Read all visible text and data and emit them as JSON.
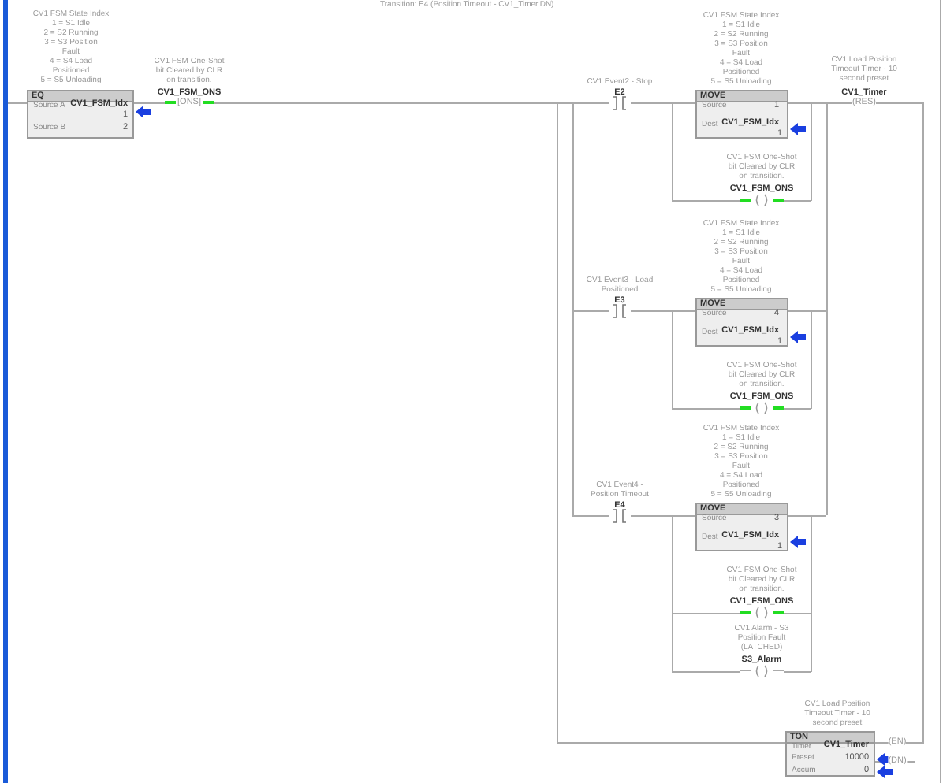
{
  "transition_note": "Transition: E4 (Position Timeout - CV1_Timer.DN)",
  "eq": {
    "comment": [
      "CV1 FSM State Index",
      "1 = S1 Idle",
      "2 = S2 Running",
      "3 = S3 Position",
      "Fault",
      "4 = S4 Load",
      "Positioned",
      "5 = S5 Unloading"
    ],
    "title": "EQ",
    "source_a_label": "Source A",
    "source_a_tag": "CV1_FSM_Idx",
    "source_a_value": "1",
    "source_b_label": "Source B",
    "source_b_value": "2"
  },
  "one_shot": {
    "comment": [
      "CV1 FSM One-Shot",
      "bit Cleared by CLR",
      "on transition."
    ],
    "tag": "CV1_FSM_ONS",
    "symbol": "[ONS]",
    "energized": true
  },
  "branches": [
    {
      "contact": {
        "comment": [
          "CV1 Event2 - Stop"
        ],
        "tag": "E2"
      },
      "move": {
        "comment": [
          "CV1 FSM State Index",
          "1 = S1 Idle",
          "2 = S2 Running",
          "3 = S3 Position",
          "Fault",
          "4 = S4 Load",
          "Positioned",
          "5 = S5 Unloading"
        ],
        "title": "MOVE",
        "source_label": "Source",
        "source_value": "1",
        "dest_label": "Dest",
        "dest_tag": "CV1_FSM_Idx",
        "dest_value": "1"
      },
      "outputs": [
        {
          "comment": [
            "CV1 FSM One-Shot",
            "bit Cleared by CLR",
            "on transition."
          ],
          "tag": "CV1_FSM_ONS",
          "energized": true
        }
      ]
    },
    {
      "contact": {
        "comment": [
          "CV1 Event3 - Load",
          "Positioned"
        ],
        "tag": "E3"
      },
      "move": {
        "comment": [
          "CV1 FSM State Index",
          "1 = S1 Idle",
          "2 = S2 Running",
          "3 = S3 Position",
          "Fault",
          "4 = S4 Load",
          "Positioned",
          "5 = S5 Unloading"
        ],
        "title": "MOVE",
        "source_label": "Source",
        "source_value": "4",
        "dest_label": "Dest",
        "dest_tag": "CV1_FSM_Idx",
        "dest_value": "1"
      },
      "outputs": [
        {
          "comment": [
            "CV1 FSM One-Shot",
            "bit Cleared by CLR",
            "on transition."
          ],
          "tag": "CV1_FSM_ONS",
          "energized": true
        }
      ]
    },
    {
      "contact": {
        "comment": [
          "CV1 Event4 -",
          "Position Timeout"
        ],
        "tag": "E4"
      },
      "move": {
        "comment": [
          "CV1 FSM State Index",
          "1 = S1 Idle",
          "2 = S2 Running",
          "3 = S3 Position",
          "Fault",
          "4 = S4 Load",
          "Positioned",
          "5 = S5 Unloading"
        ],
        "title": "MOVE",
        "source_label": "Source",
        "source_value": "3",
        "dest_label": "Dest",
        "dest_tag": "CV1_FSM_Idx",
        "dest_value": "1"
      },
      "outputs": [
        {
          "comment": [
            "CV1 FSM One-Shot",
            "bit Cleared by CLR",
            "on transition."
          ],
          "tag": "CV1_FSM_ONS",
          "energized": true
        },
        {
          "comment": [
            "CV1 Alarm - S3",
            "Position Fault",
            "(LATCHED)"
          ],
          "tag": "S3_Alarm",
          "energized": false
        }
      ]
    }
  ],
  "reset": {
    "comment": [
      "CV1 Load Position",
      "Timeout Timer - 10",
      "second preset"
    ],
    "tag": "CV1_Timer",
    "symbol": "(RES)"
  },
  "timer": {
    "comment": [
      "CV1 Load Position",
      "Timeout Timer - 10",
      "second preset"
    ],
    "title": "TON",
    "timer_label": "Timer",
    "timer_tag": "CV1_Timer",
    "preset_label": "Preset",
    "preset_value": "10000",
    "accum_label": "Accum",
    "accum_value": "0",
    "outputs": [
      "(EN)",
      "(DN)"
    ]
  }
}
